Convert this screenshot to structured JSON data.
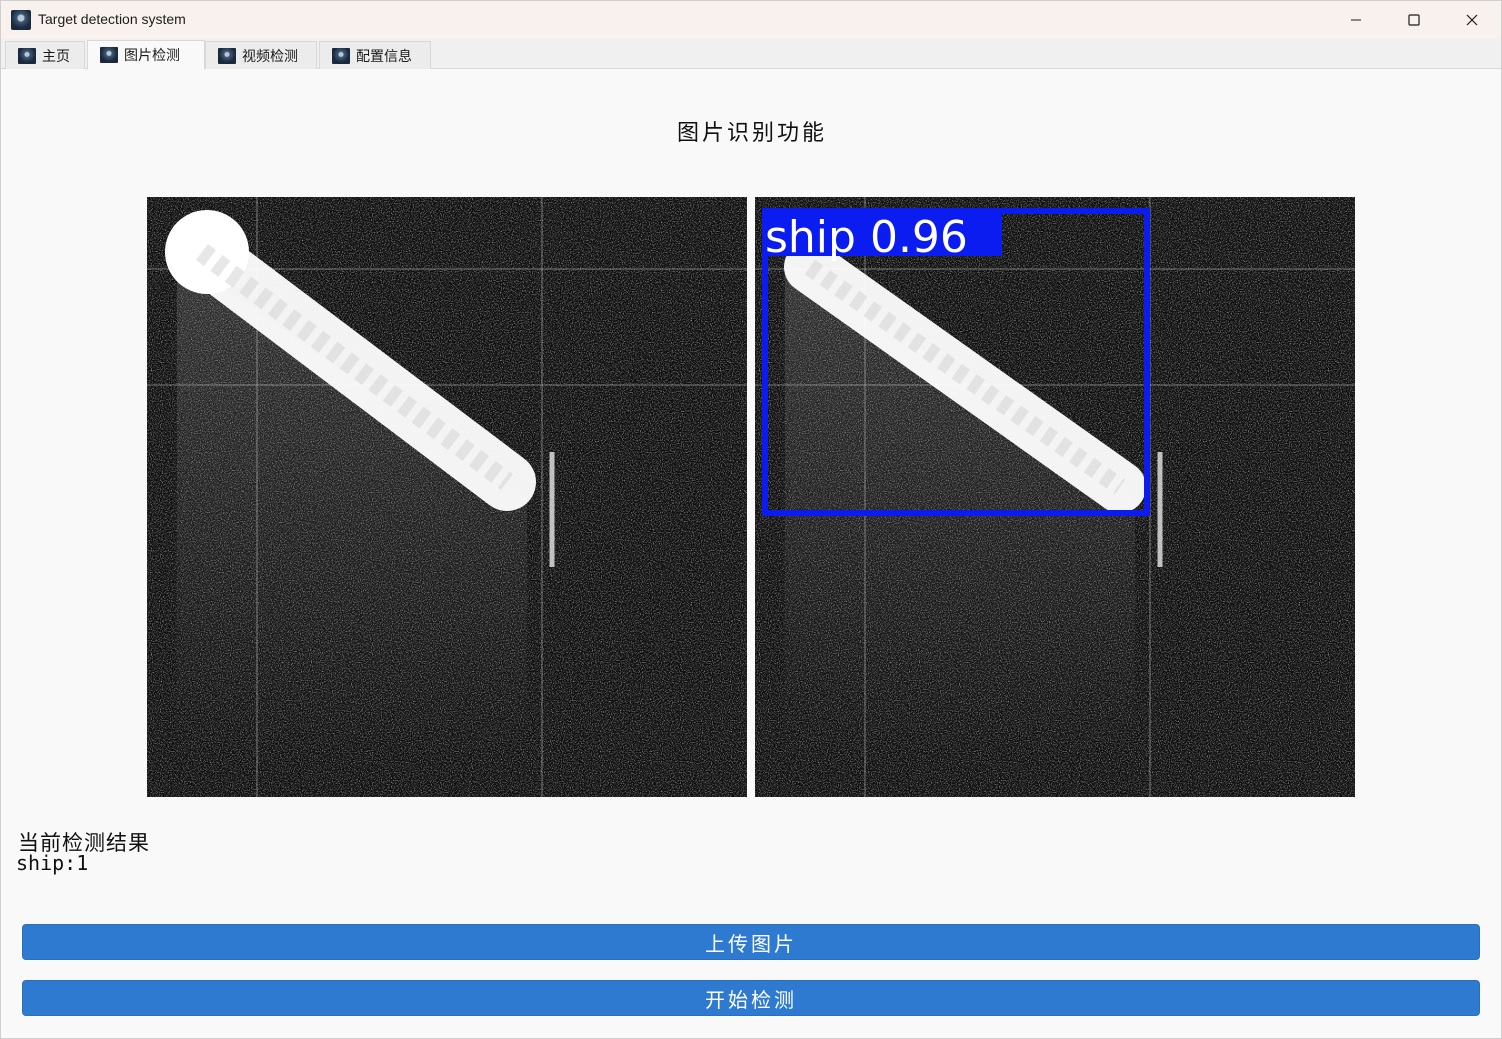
{
  "window": {
    "title": "Target detection system",
    "controls": [
      "minimize",
      "maximize",
      "close"
    ]
  },
  "tabs": [
    {
      "label": "主页",
      "icon": "app-logo-icon",
      "active": false
    },
    {
      "label": "图片检测",
      "icon": "app-logo-icon",
      "active": true
    },
    {
      "label": "视频检测",
      "icon": "app-logo-icon",
      "active": false
    },
    {
      "label": "配置信息",
      "icon": "app-logo-icon",
      "active": false
    }
  ],
  "main": {
    "title": "图片识别功能",
    "original_image": {
      "description_icon": "sar-image"
    },
    "detected_image": {
      "detection": {
        "label": "ship 0.96",
        "box_color": "#0a1cf0"
      }
    },
    "result_label": "当前检测结果",
    "result_value": "ship:1"
  },
  "buttons": {
    "upload_label": "上传图片",
    "detect_label": "开始检测",
    "color": "#2f7ad1"
  }
}
